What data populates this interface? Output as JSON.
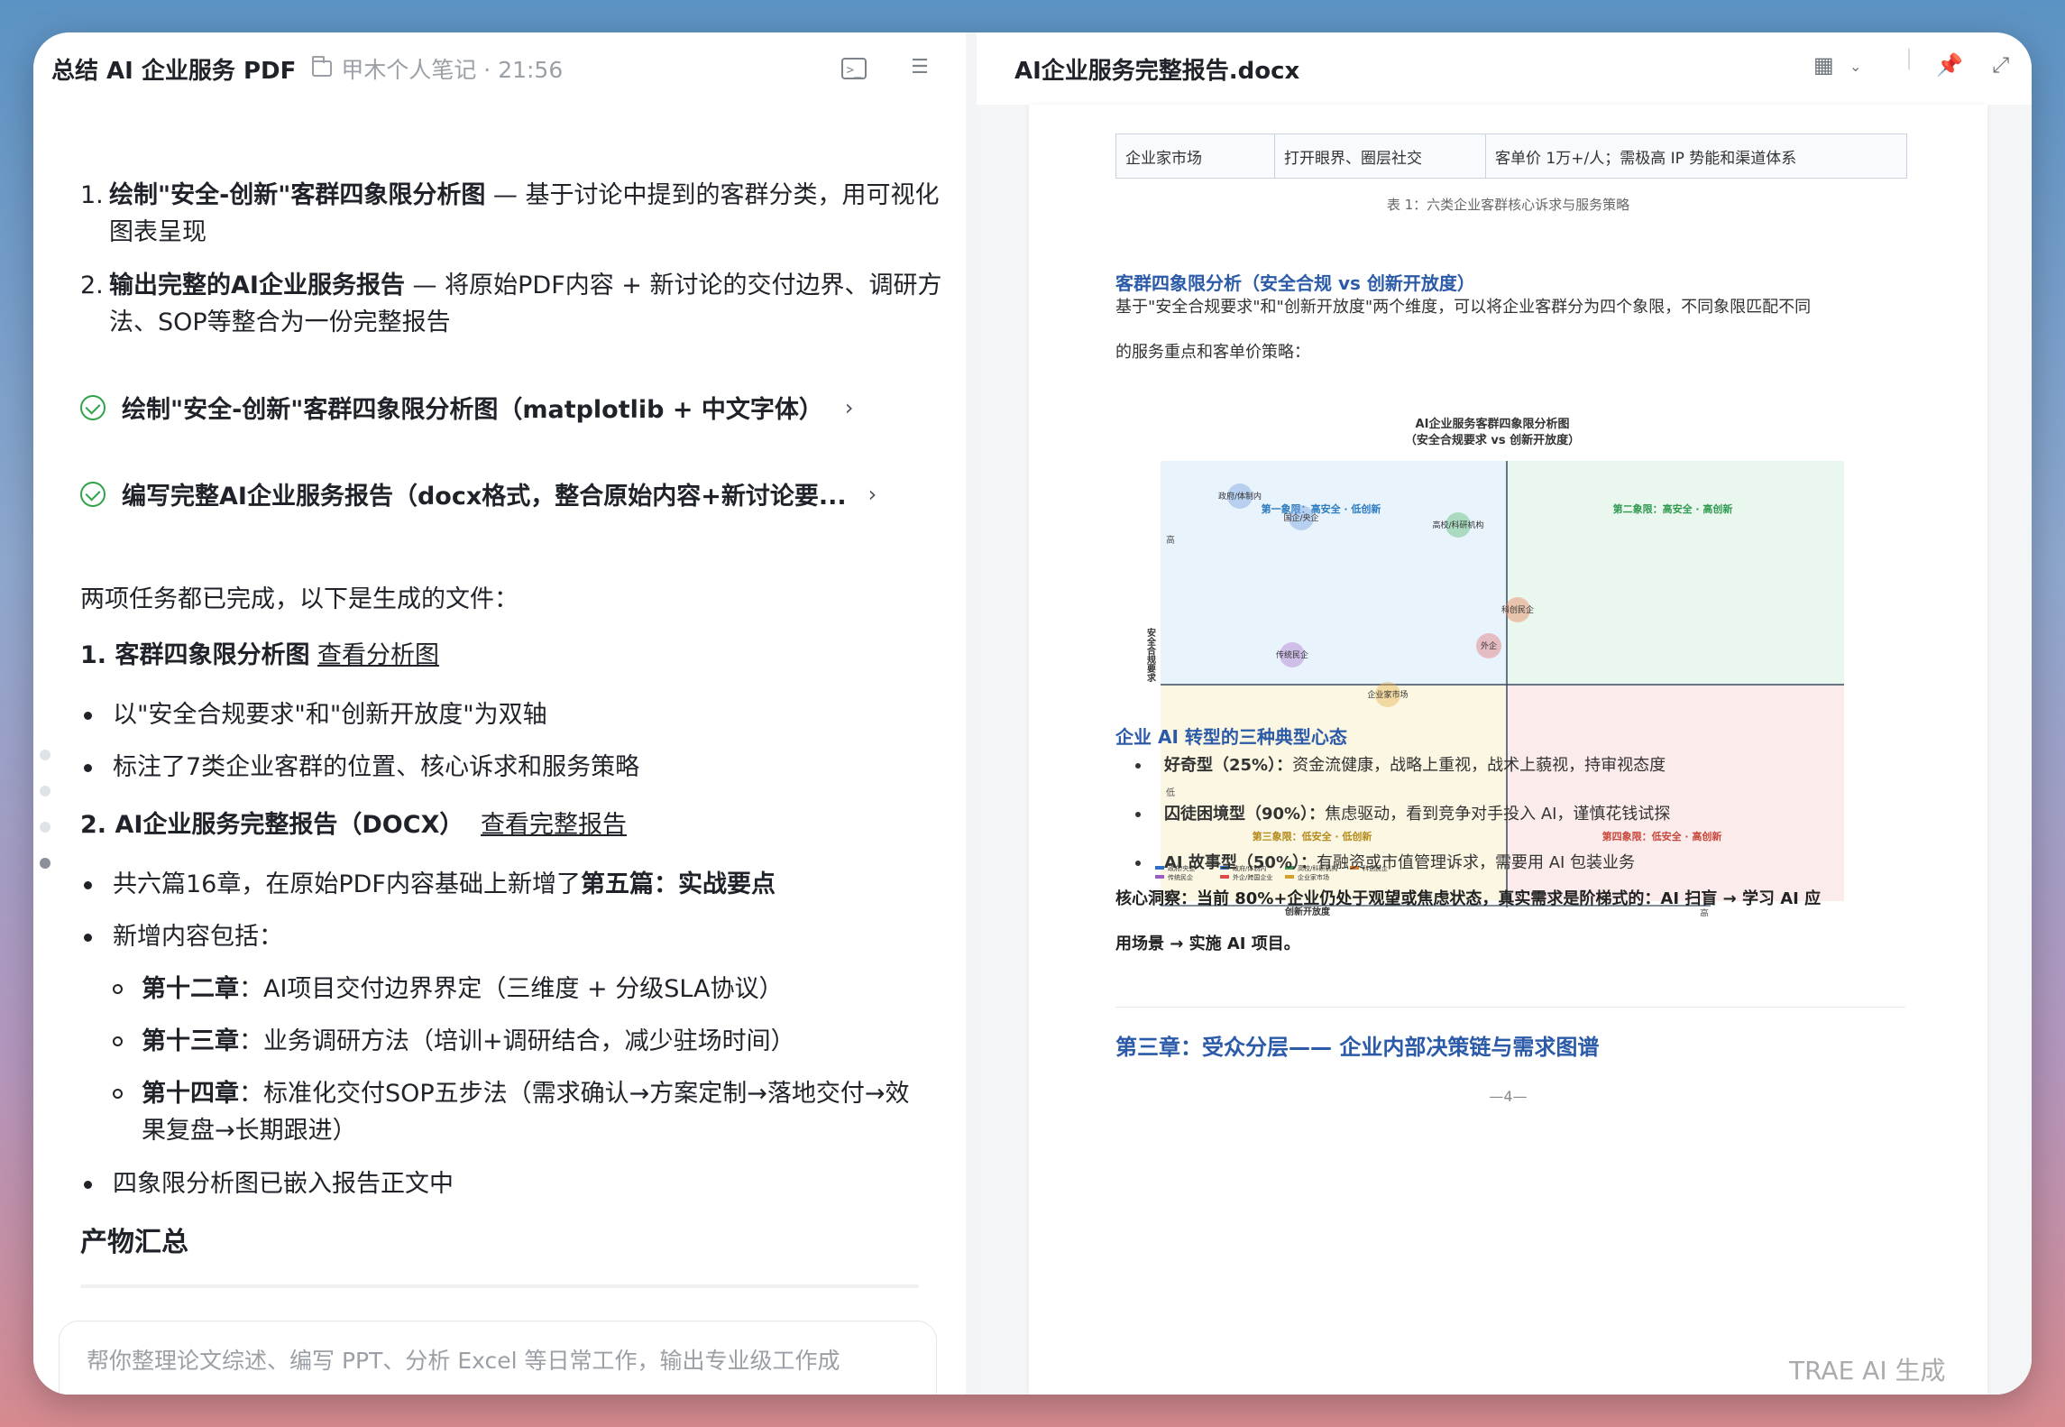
{
  "left": {
    "title": "总结 AI 企业服务 PDF",
    "folder": "甲木个人笔记 · 21:56",
    "list1": [
      {
        "num": "1.",
        "bold": "绘制\"安全-创新\"客群四象限分析图",
        "rest": " — 基于讨论中提到的客群分类，用可视化图表呈现"
      },
      {
        "num": "2.",
        "bold": "输出完整的AI企业服务报告",
        "rest": " — 将原始PDF内容 + 新讨论的交付边界、调研方法、SOP等整合为一份完整报告"
      }
    ],
    "tasks": [
      "绘制\"安全-创新\"客群四象限分析图（matplotlib + 中文字体）",
      "编写完整AI企业服务报告（docx格式，整合原始内容+新讨论要..."
    ],
    "done_text": "两项任务都已完成，以下是生成的文件：",
    "file1_label": "1. 客群四象限分析图",
    "file1_link": "查看分析图",
    "file1_bullets": [
      "以\"安全合规要求\"和\"创新开放度\"为双轴",
      "标注了7类企业客群的位置、核心诉求和服务策略"
    ],
    "file2_label": "2. AI企业服务完整报告（DOCX）",
    "file2_link": "查看完整报告",
    "file2_b1_pre": "共六篇16章，在原始PDF内容基础上新增了",
    "file2_b1_bold": "第五篇：实战要点",
    "file2_b2": "新增内容包括：",
    "sub_items": [
      {
        "bold": "第十二章",
        "rest": "：AI项目交付边界界定（三维度 + 分级SLA协议）"
      },
      {
        "bold": "第十三章",
        "rest": "：业务调研方法（培训+调研结合，减少驻场时间）"
      },
      {
        "bold": "第十四章",
        "rest": "：标准化交付SOP五步法（需求确认→方案定制→落地交付→效果复盘→长期跟进）"
      }
    ],
    "file2_b3": "四象限分析图已嵌入报告正文中",
    "summary_heading": "产物汇总",
    "input_placeholder": "帮你整理论文综述、编写 PPT、分析 Excel 等日常工作，输出专业级工作成"
  },
  "right": {
    "title": "AI企业服务完整报告.docx",
    "table_row": [
      "企业家市场",
      "打开眼界、圈层社交",
      "客单价 1万+/人；需极高 IP 势能和渠道体系"
    ],
    "table_caption": "表 1：六类企业客群核心诉求与服务策略",
    "section1_heading": "客群四象限分析（安全合规 vs 创新开放度）",
    "section1_para_line1": "基于\"安全合规要求\"和\"创新开放度\"两个维度，可以将企业客群分为四个象限，不同象限匹配不同",
    "section1_para_line2": "的服务重点和客单价策略：",
    "section2_heading": "企业 AI 转型的三种典型心态",
    "mindsets": [
      {
        "bold": "好奇型（25%）：",
        "rest": "资金流健康，战略上重视，战术上藐视，持审视态度"
      },
      {
        "bold": "囚徒困境型（90%）：",
        "rest": "焦虑驱动，看到竞争对手投入 AI，谨慎花钱试探"
      },
      {
        "bold": "AI 故事型（50%）：",
        "rest": "有融资或市值管理诉求，需要用 AI 包装业务"
      }
    ],
    "insight_line1": "核心洞察：当前 80%+企业仍处于观望或焦虑状态，真实需求是阶梯式的：AI 扫盲 → 学习 AI 应",
    "insight_line2": "用场景 → 实施 AI 项目。",
    "chapter_heading": "第三章：受众分层—— 企业内部决策链与需求图谱",
    "page_number": "—4—"
  },
  "chart": {
    "title_line1": "AI企业服务客群四象限分析图",
    "title_line2": "（安全合规要求 vs 创新开放度）",
    "q1": "第一象限：高安全 · 低创新",
    "q2": "第二象限：高安全 · 高创新",
    "q3": "第三象限：低安全 · 低创新",
    "q4": "第四象限：低安全 · 高创新",
    "ylabel": "安全合规要求",
    "xlabel": "创新开放度",
    "y_high": "高",
    "y_low": "低",
    "x_high": "高",
    "nodes": [
      {
        "label": "政府/体制内",
        "color": "#7fa7e0"
      },
      {
        "label": "国企/央企",
        "color": "#7fa7e0"
      },
      {
        "label": "高校/科研机构",
        "color": "#5fbf7a"
      },
      {
        "label": "科创民企",
        "color": "#e8865a"
      },
      {
        "label": "传统民企",
        "color": "#b07fd1"
      },
      {
        "label": "企业家市场",
        "color": "#e6b450"
      },
      {
        "label": "外企",
        "color": "#e07a7a"
      }
    ],
    "legend": [
      "政府/央企",
      "政府/体制内",
      "高校/科研机构",
      "科创民企",
      "传统民企",
      "外企/跨国企业",
      "企业家市场"
    ]
  },
  "watermark": "TRAE AI 生成",
  "colors": {
    "doc_heading": "#2b5aa8",
    "check": "#2fa34a"
  }
}
